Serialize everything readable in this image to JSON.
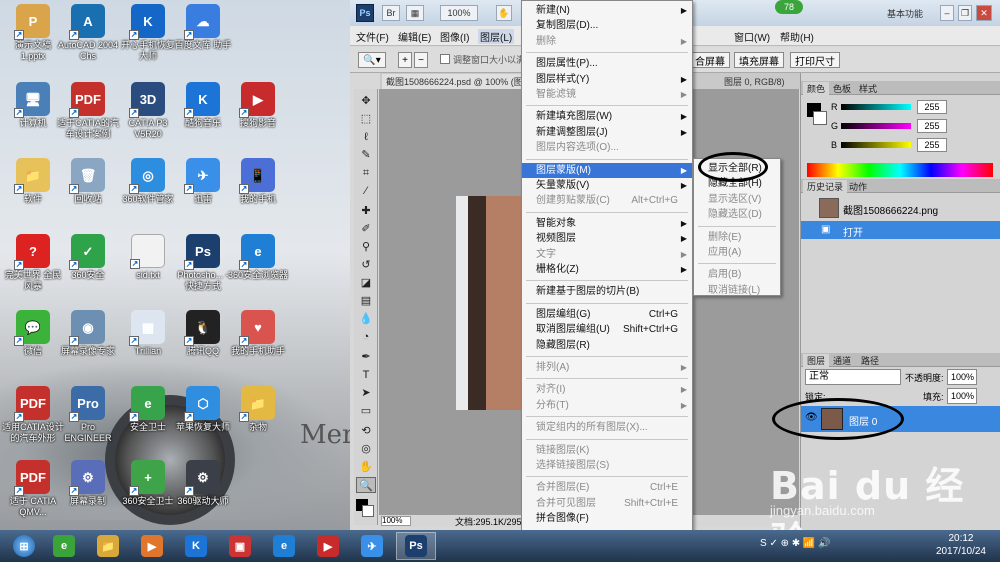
{
  "desktop": {
    "icons": [
      {
        "label": "演示文稿 1.pptx",
        "color": "#d9a44a",
        "glyph": "P"
      },
      {
        "label": "AutoCAD 2004 Chs",
        "color": "#1a6fb0",
        "glyph": "A"
      },
      {
        "label": "开心手机恢复大师",
        "color": "#1467c6",
        "glyph": "K"
      },
      {
        "label": "百度文库 助手",
        "color": "#3a7de0",
        "glyph": "☁"
      },
      {
        "label": "计算机",
        "color": "#4a7fb8",
        "glyph": "🖥"
      },
      {
        "label": "适于CATIA的汽车设计案例",
        "color": "#c4302b",
        "glyph": "PDF"
      },
      {
        "label": "CATIA P3 V5R20",
        "color": "#2b4c7e",
        "glyph": "3D"
      },
      {
        "label": "酷狗音乐",
        "color": "#1c74d6",
        "glyph": "K"
      },
      {
        "label": "搜狗影音",
        "color": "#c82b2b",
        "glyph": "▶"
      },
      {
        "label": "软件",
        "color": "#e7c15a",
        "glyph": "📁"
      },
      {
        "label": "回收站",
        "color": "#8aa6c2",
        "glyph": "🗑"
      },
      {
        "label": "360软件管家",
        "color": "#2d8ee0",
        "glyph": "◎"
      },
      {
        "label": "迅雷",
        "color": "#3a8fe8",
        "glyph": "✈"
      },
      {
        "label": "我的手机",
        "color": "#4b6fd6",
        "glyph": "📱"
      },
      {
        "label": "完美世界 全民风暴",
        "color": "#d22",
        "glyph": "?"
      },
      {
        "label": "360安全",
        "color": "#2ea34a",
        "glyph": "✓"
      },
      {
        "label": "sid.txt",
        "color": "#f2f2f2",
        "glyph": ""
      },
      {
        "label": "Photosho... - 快捷方式",
        "color": "#1c3f6e",
        "glyph": "Ps"
      },
      {
        "label": "360安全浏览器",
        "color": "#1f7fd4",
        "glyph": "e"
      },
      {
        "label": "微信",
        "color": "#3bb33b",
        "glyph": "💬"
      },
      {
        "label": "屏幕录像专家",
        "color": "#6d8fb2",
        "glyph": "◉"
      },
      {
        "label": "Trillian",
        "color": "#dde6f0",
        "glyph": "▦"
      },
      {
        "label": "腾讯QQ",
        "color": "#222",
        "glyph": "🐧"
      },
      {
        "label": "我的手机助手",
        "color": "#d9534f",
        "glyph": "♥"
      },
      {
        "label": "适用CATIA设计的汽车外形",
        "color": "#c4302b",
        "glyph": "PDF"
      },
      {
        "label": "Pro ENGINEER",
        "color": "#3c6ca8",
        "glyph": "Pro"
      },
      {
        "label": "安全卫士",
        "color": "#37a34a",
        "glyph": "e"
      },
      {
        "label": "苹果恢复大师",
        "color": "#2f8ee0",
        "glyph": "⬡"
      },
      {
        "label": "杂物",
        "color": "#e4b943",
        "glyph": "📁"
      },
      {
        "label": "适于 CATIA QMV...",
        "color": "#c4302b",
        "glyph": "PDF"
      },
      {
        "label": "屏幕录制",
        "color": "#5a6db8",
        "glyph": "⚙"
      },
      {
        "label": "360安全卫士",
        "color": "#3fa34a",
        "glyph": "+"
      },
      {
        "label": "360驱动大师",
        "color": "#3a3f48",
        "glyph": "⚙"
      }
    ],
    "wallpaper_text": "Mer"
  },
  "photoshop": {
    "logo": "Ps",
    "title_buttons": [
      "Br",
      "100%"
    ],
    "workspace": "基本功能",
    "badge": "78",
    "menubar": [
      "文件(F)",
      "编辑(E)",
      "图像(I)",
      "图层(L)",
      "窗口(W)",
      "帮助(H)"
    ],
    "options": {
      "checkbox_label": "调整窗口大小以满",
      "buttons": [
        "合屏幕",
        "填充屏幕",
        "打印尺寸"
      ]
    },
    "doc_tabs": [
      "截图1508666224.psd @ 100% (图层",
      "图层 0, RGB/8)"
    ],
    "status": {
      "zoom": "100%",
      "doc": "文档:295.1K/295."
    },
    "color_panel": {
      "tabs": [
        "颜色",
        "色板",
        "样式"
      ],
      "rows": [
        {
          "label": "R",
          "value": "255",
          "color": "#00ffff"
        },
        {
          "label": "G",
          "value": "255",
          "color": "#ff00ff"
        },
        {
          "label": "B",
          "value": "255",
          "color": "#ffff00"
        }
      ]
    },
    "history_panel": {
      "tabs": [
        "历史记录",
        "动作"
      ],
      "snapshot": "截图1508666224.png",
      "step": "打开"
    },
    "layers_panel": {
      "tabs": [
        "图层",
        "通道",
        "路径"
      ],
      "blend_mode": "正常",
      "opacity_label": "不透明度:",
      "opacity": "100%",
      "lock_label": "锁定:",
      "fill_label": "填充:",
      "fill": "100%",
      "layer_name": "图层 0"
    }
  },
  "layer_menu": {
    "items": [
      {
        "label": "新建(N)",
        "shortcut": "",
        "arrow": true,
        "disabled": false
      },
      {
        "label": "复制图层(D)...",
        "shortcut": "",
        "arrow": false,
        "disabled": false
      },
      {
        "label": "删除",
        "shortcut": "",
        "arrow": true,
        "disabled": true
      },
      {
        "sep": true
      },
      {
        "label": "图层属性(P)...",
        "shortcut": "",
        "arrow": false,
        "disabled": false
      },
      {
        "label": "图层样式(Y)",
        "shortcut": "",
        "arrow": true,
        "disabled": false
      },
      {
        "label": "智能滤镜",
        "shortcut": "",
        "arrow": true,
        "disabled": true
      },
      {
        "sep": true
      },
      {
        "label": "新建填充图层(W)",
        "shortcut": "",
        "arrow": true,
        "disabled": false
      },
      {
        "label": "新建调整图层(J)",
        "shortcut": "",
        "arrow": true,
        "disabled": false
      },
      {
        "label": "图层内容选项(O)...",
        "shortcut": "",
        "arrow": false,
        "disabled": true
      },
      {
        "sep": true
      },
      {
        "label": "图层蒙版(M)",
        "shortcut": "",
        "arrow": true,
        "disabled": false,
        "highlight": true
      },
      {
        "label": "矢量蒙版(V)",
        "shortcut": "",
        "arrow": true,
        "disabled": false
      },
      {
        "label": "创建剪贴蒙版(C)",
        "shortcut": "Alt+Ctrl+G",
        "arrow": false,
        "disabled": true
      },
      {
        "sep": true
      },
      {
        "label": "智能对象",
        "shortcut": "",
        "arrow": true,
        "disabled": false
      },
      {
        "label": "视频图层",
        "shortcut": "",
        "arrow": true,
        "disabled": false
      },
      {
        "label": "文字",
        "shortcut": "",
        "arrow": true,
        "disabled": true
      },
      {
        "label": "栅格化(Z)",
        "shortcut": "",
        "arrow": true,
        "disabled": false
      },
      {
        "sep": true
      },
      {
        "label": "新建基于图层的切片(B)",
        "shortcut": "",
        "arrow": false,
        "disabled": false
      },
      {
        "sep": true
      },
      {
        "label": "图层编组(G)",
        "shortcut": "Ctrl+G",
        "arrow": false,
        "disabled": false
      },
      {
        "label": "取消图层编组(U)",
        "shortcut": "Shift+Ctrl+G",
        "arrow": false,
        "disabled": false
      },
      {
        "label": "隐藏图层(R)",
        "shortcut": "",
        "arrow": false,
        "disabled": false
      },
      {
        "sep": true
      },
      {
        "label": "排列(A)",
        "shortcut": "",
        "arrow": true,
        "disabled": true
      },
      {
        "sep": true
      },
      {
        "label": "对齐(I)",
        "shortcut": "",
        "arrow": true,
        "disabled": true
      },
      {
        "label": "分布(T)",
        "shortcut": "",
        "arrow": true,
        "disabled": true
      },
      {
        "sep": true
      },
      {
        "label": "锁定组内的所有图层(X)...",
        "shortcut": "",
        "arrow": false,
        "disabled": true
      },
      {
        "sep": true
      },
      {
        "label": "链接图层(K)",
        "shortcut": "",
        "arrow": false,
        "disabled": true
      },
      {
        "label": "选择链接图层(S)",
        "shortcut": "",
        "arrow": false,
        "disabled": true
      },
      {
        "sep": true
      },
      {
        "label": "合并图层(E)",
        "shortcut": "Ctrl+E",
        "arrow": false,
        "disabled": true
      },
      {
        "label": "合并可见图层",
        "shortcut": "Shift+Ctrl+E",
        "arrow": false,
        "disabled": true
      },
      {
        "label": "拼合图像(F)",
        "shortcut": "",
        "arrow": false,
        "disabled": false
      },
      {
        "sep": true
      },
      {
        "label": "修边",
        "shortcut": "",
        "arrow": true,
        "disabled": false
      }
    ]
  },
  "mask_submenu": {
    "items": [
      {
        "label": "显示全部(R)",
        "disabled": false
      },
      {
        "label": "隐藏全部(H)",
        "disabled": false
      },
      {
        "label": "显示选区(V)",
        "disabled": true
      },
      {
        "label": "隐藏选区(D)",
        "disabled": true
      },
      {
        "sep": true
      },
      {
        "label": "删除(E)",
        "disabled": true
      },
      {
        "label": "应用(A)",
        "disabled": true
      },
      {
        "sep": true
      },
      {
        "label": "启用(B)",
        "disabled": true
      },
      {
        "label": "取消链接(L)",
        "disabled": true
      }
    ]
  },
  "watermark": {
    "logo": "Bai du 经验",
    "url": "jingyan.baidu.com"
  },
  "taskbar": {
    "apps": [
      {
        "glyph": "e",
        "color": "#3aa33a"
      },
      {
        "glyph": "📁",
        "color": "#d9a83b"
      },
      {
        "glyph": "▶",
        "color": "#e0762b"
      },
      {
        "glyph": "K",
        "color": "#1c74d6"
      },
      {
        "glyph": "▣",
        "color": "#c33"
      },
      {
        "glyph": "e",
        "color": "#1f7fd4"
      },
      {
        "glyph": "▶",
        "color": "#c82b2b"
      },
      {
        "glyph": "✈",
        "color": "#3a8fe8"
      },
      {
        "glyph": "Ps",
        "color": "#1c3f6e"
      }
    ],
    "time": "20:12",
    "date": "2017/10/24"
  }
}
